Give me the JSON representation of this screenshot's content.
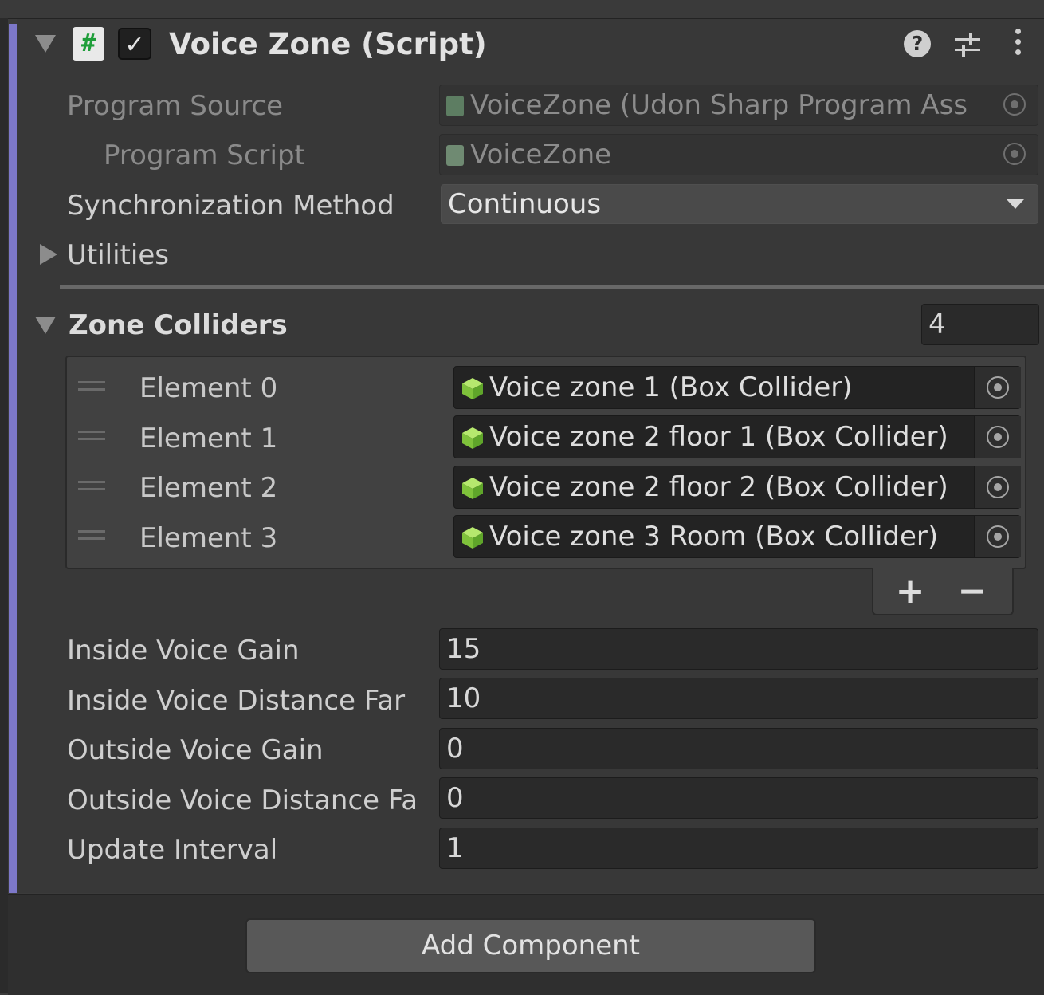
{
  "component": {
    "title": "Voice Zone (Script)",
    "script_icon": "#",
    "enabled_mark": "✓",
    "help_icon": "?",
    "icons": [
      "collapse-triangle-icon",
      "csharp-script-icon",
      "checkbox-checked-icon",
      "help-icon",
      "presets-sliders-icon",
      "kebab-menu-icon"
    ]
  },
  "fields": {
    "program_source": {
      "label": "Program Source",
      "value": "VoiceZone (Udon Sharp Program Ass"
    },
    "program_script": {
      "label": "Program Script",
      "value": "VoiceZone"
    },
    "sync_method": {
      "label": "Synchronization Method",
      "value": "Continuous"
    },
    "utilities": {
      "label": "Utilities"
    }
  },
  "zone_colliders": {
    "label": "Zone Colliders",
    "count": "4",
    "elements": [
      {
        "label": "Element 0",
        "value": "Voice zone 1 (Box Collider)"
      },
      {
        "label": "Element 1",
        "value": "Voice zone 2 floor 1 (Box Collider)"
      },
      {
        "label": "Element 2",
        "value": "Voice zone 2 floor 2 (Box Collider)"
      },
      {
        "label": "Element 3",
        "value": "Voice zone 3 Room (Box Collider)"
      }
    ],
    "add_label": "+",
    "remove_label": "−"
  },
  "voice_settings": [
    {
      "label": "Inside Voice Gain",
      "value": "15"
    },
    {
      "label": "Inside Voice Distance Far",
      "value": "10"
    },
    {
      "label": "Outside Voice Gain",
      "value": "0"
    },
    {
      "label": "Outside Voice Distance Fa",
      "value": "0"
    },
    {
      "label": "Update Interval",
      "value": "1"
    }
  ],
  "footer": {
    "add_component_label": "Add Component"
  },
  "colors": {
    "accent": "#7d78c9",
    "panel_bg": "#383838",
    "field_bg": "#2a2a2a",
    "cube_icon": "#8fd14f"
  }
}
